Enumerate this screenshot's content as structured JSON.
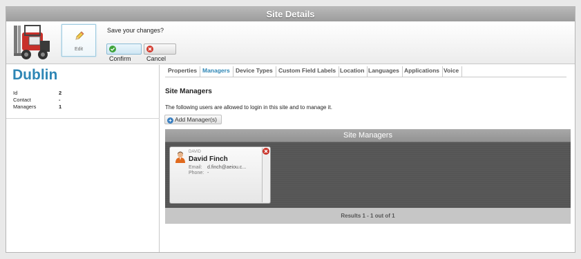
{
  "window": {
    "title": "Site Details"
  },
  "toolbar": {
    "edit_label": "Edit",
    "save_prompt": "Save your changes?",
    "confirm_label": "Confirm",
    "cancel_label": "Cancel"
  },
  "site": {
    "name": "Dublin",
    "props": [
      {
        "key": "Id",
        "value": "2"
      },
      {
        "key": "Contact",
        "value": "-"
      },
      {
        "key": "Managers",
        "value": "1"
      }
    ]
  },
  "tabs": [
    {
      "label": "Properties",
      "active": false
    },
    {
      "label": "Managers",
      "active": true
    },
    {
      "label": "Device Types",
      "active": false
    },
    {
      "label": "Custom Field Labels",
      "active": false
    },
    {
      "label": "Location",
      "active": false
    },
    {
      "label": "Languages",
      "active": false
    },
    {
      "label": "Applications",
      "active": false
    },
    {
      "label": "Voice",
      "active": false
    }
  ],
  "managers_section": {
    "title": "Site Managers",
    "description": "The following users are allowed to login in this site and to manage it.",
    "add_button": "Add Manager(s)",
    "grid_title": "Site Managers",
    "results": "Results 1 - 1 out of 1",
    "cards": [
      {
        "role": "DAVID",
        "name": "David Finch",
        "email_label": "Email:",
        "email": "d.finch@aeiou.c...",
        "phone_label": "Phone:",
        "phone": "-"
      }
    ]
  },
  "colors": {
    "accent": "#2e86b5",
    "confirm": "#3ea33a",
    "cancel": "#d23b2f"
  }
}
